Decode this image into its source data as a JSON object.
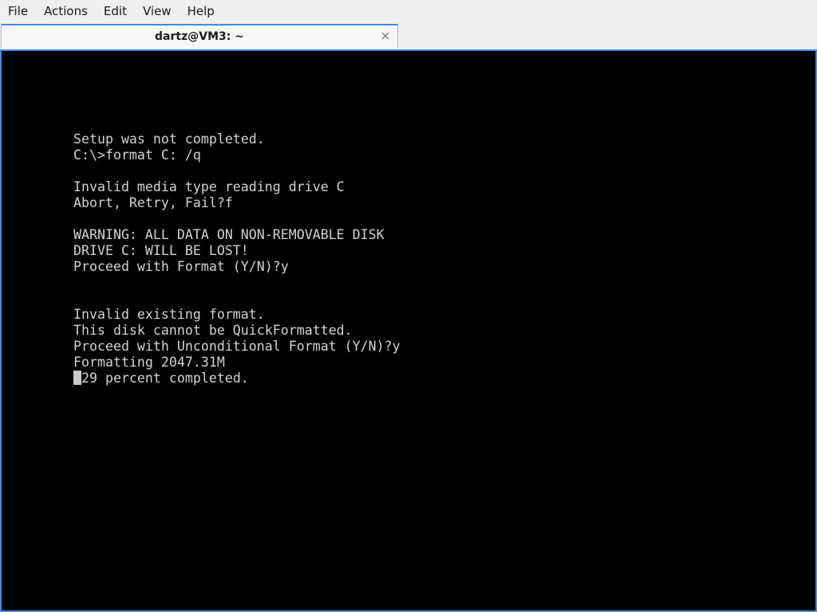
{
  "menubar": {
    "items": [
      "File",
      "Actions",
      "Edit",
      "View",
      "Help"
    ]
  },
  "tab": {
    "title": "dartz@VM3: ~"
  },
  "terminal": {
    "lines": [
      "Setup was not completed.",
      "C:\\>format C: /q",
      "",
      "Invalid media type reading drive C",
      "Abort, Retry, Fail?f",
      "",
      "WARNING: ALL DATA ON NON-REMOVABLE DISK",
      "DRIVE C: WILL BE LOST!",
      "Proceed with Format (Y/N)?y",
      "",
      "",
      "Invalid existing format.",
      "This disk cannot be QuickFormatted.",
      "Proceed with Unconditional Format (Y/N)?y",
      "Formatting 2047.31M"
    ],
    "last_line": "29 percent completed."
  },
  "colors": {
    "accent": "#3d8ee0",
    "terminal_bg": "#000000",
    "terminal_fg": "#d2d2d2"
  }
}
